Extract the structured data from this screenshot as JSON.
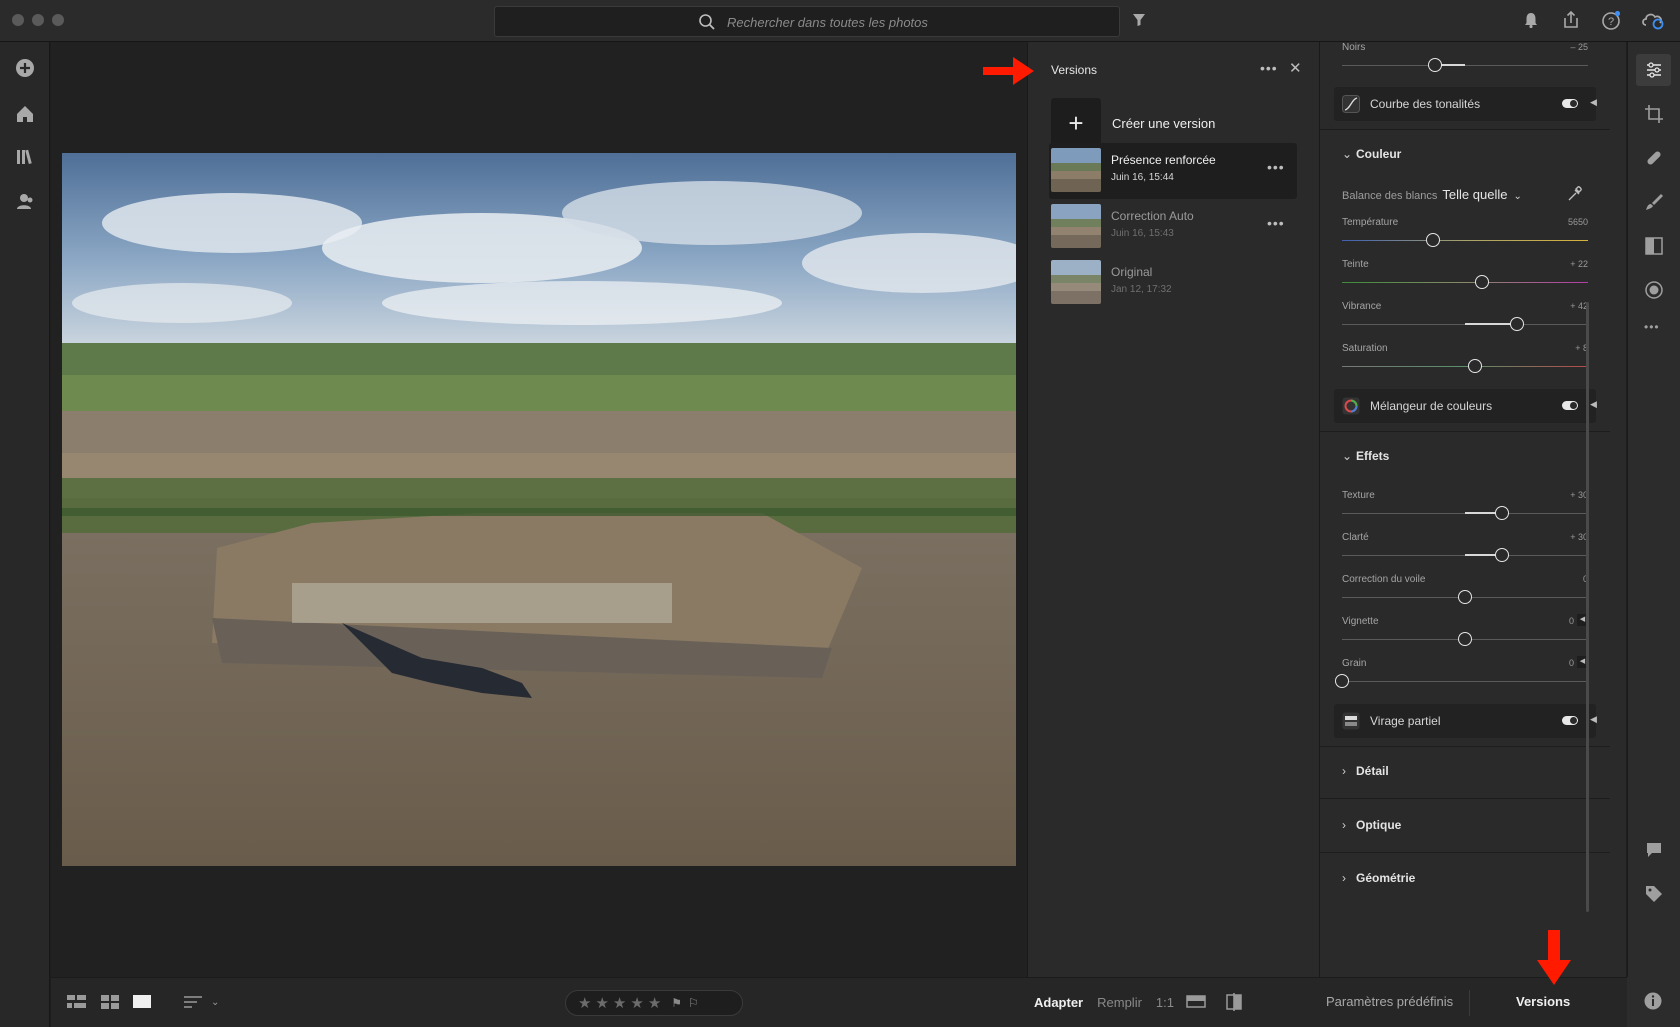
{
  "search": {
    "placeholder": "Rechercher dans toutes les photos"
  },
  "versions_panel": {
    "title": "Versions",
    "create_label": "Créer une version",
    "items": [
      {
        "name": "Présence renforcée",
        "date": "Juin 16, 15:44",
        "selected": true
      },
      {
        "name": "Correction Auto",
        "date": "Juin 16, 15:43",
        "selected": false
      },
      {
        "name": "Original",
        "date": "Jan 12, 17:32",
        "selected": false
      }
    ]
  },
  "edit": {
    "noirs": {
      "label": "Noirs",
      "value": "– 25",
      "fraction": 0.38
    },
    "tone_curve": {
      "label": "Courbe des tonalités"
    },
    "couleur": {
      "title": "Couleur",
      "wb_label": "Balance des blancs",
      "wb_value": "Telle quelle",
      "temperature": {
        "label": "Température",
        "value": "5650",
        "fraction": 0.37
      },
      "teinte": {
        "label": "Teinte",
        "value": "+ 22",
        "fraction": 0.57
      },
      "vibrance": {
        "label": "Vibrance",
        "value": "+ 42",
        "fraction": 0.71
      },
      "saturation": {
        "label": "Saturation",
        "value": "+ 8",
        "fraction": 0.54
      }
    },
    "mixer": {
      "label": "Mélangeur de couleurs"
    },
    "effets": {
      "title": "Effets",
      "texture": {
        "label": "Texture",
        "value": "+ 30",
        "fraction": 0.65
      },
      "clarte": {
        "label": "Clarté",
        "value": "+ 30",
        "fraction": 0.65
      },
      "voile": {
        "label": "Correction du voile",
        "value": "0",
        "fraction": 0.5
      },
      "vignette": {
        "label": "Vignette",
        "value": "0",
        "fraction": 0.5
      },
      "grain": {
        "label": "Grain",
        "value": "0",
        "fraction": 0.0
      }
    },
    "split": {
      "label": "Virage partiel"
    },
    "detail": "Détail",
    "optique": "Optique",
    "geometrie": "Géométrie"
  },
  "bottom": {
    "zoom_fit": "Adapter",
    "zoom_fill": "Remplir",
    "zoom_1to1": "1:1",
    "presets": "Paramètres prédéfinis",
    "versions": "Versions"
  },
  "colors": {
    "accent_arrow": "#ff1a00",
    "panel": "#2a2a2a"
  }
}
